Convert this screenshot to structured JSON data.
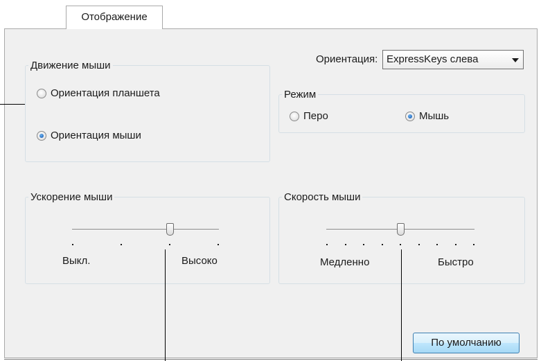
{
  "tabs": {
    "active_label": "Отображение"
  },
  "mouse_movement": {
    "legend": "Движение мыши",
    "options": [
      {
        "label": "Ориентация планшета",
        "checked": false
      },
      {
        "label": "Ориентация мыши",
        "checked": true
      }
    ]
  },
  "orientation": {
    "label": "Ориентация:",
    "selected": "ExpressKeys слева"
  },
  "mode": {
    "legend": "Режим",
    "options": [
      {
        "label": "Перо",
        "checked": false
      },
      {
        "label": "Мышь",
        "checked": true
      }
    ]
  },
  "mouse_acceleration": {
    "legend": "Ускорение мыши",
    "min_label": "Выкл.",
    "max_label": "Высоко",
    "tick_count": 4,
    "value_index": 2
  },
  "mouse_speed": {
    "legend": "Скорость мыши",
    "min_label": "Медленно",
    "max_label": "Быстро",
    "tick_count": 9,
    "value_index": 4
  },
  "default_button": {
    "label": "По умолчанию"
  }
}
